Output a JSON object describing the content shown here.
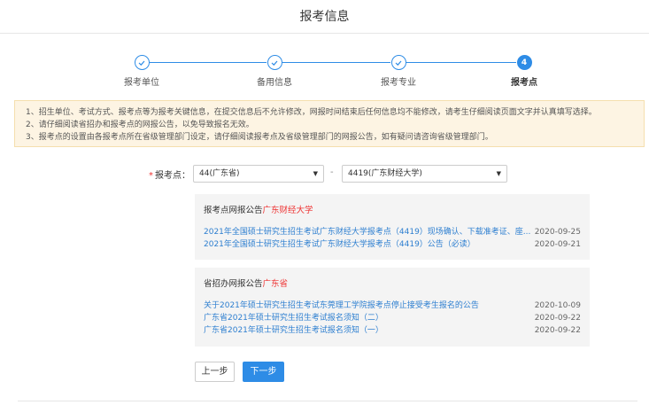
{
  "header": {
    "title": "报考信息"
  },
  "steps": [
    {
      "label": "报考单位",
      "state": "done"
    },
    {
      "label": "备用信息",
      "state": "done"
    },
    {
      "label": "报考专业",
      "state": "done"
    },
    {
      "label": "报考点",
      "state": "active",
      "number": "4"
    }
  ],
  "notice": {
    "lines": [
      "1、招生单位、考试方式、报考点等为报考关键信息，在提交信息后不允许修改，网报时间结束后任何信息均不能修改，请考生仔细阅读页面文字并认真填写选择。",
      "2、请仔细阅读省招办和报考点的网报公告，以免导致报名无效。",
      "3、报考点的设置由各报考点所在省级管理部门设定，请仔细阅读报考点及省级管理部门的网报公告，如有疑问请咨询省级管理部门。"
    ]
  },
  "selector": {
    "required_mark": "*",
    "label": "报考点：",
    "province_value": "44(广东省)",
    "separator": "-",
    "site_value": "4419(广东财经大学)",
    "arrow": "▼"
  },
  "site_panel": {
    "title": "报考点网报公告",
    "title_highlight": "广东财经大学",
    "items": [
      {
        "text": "2021年全国硕士研究生招生考试广东财经大学报考点（4419）现场确认、下载准考证、座...",
        "date": "2020-09-25"
      },
      {
        "text": "2021年全国硕士研究生招生考试广东财经大学报考点（4419）公告（必读）",
        "date": "2020-09-21"
      }
    ]
  },
  "province_panel": {
    "title": "省招办网报公告",
    "title_highlight": "广东省",
    "items": [
      {
        "text": "关于2021年硕士研究生招生考试东莞理工学院报考点停止接受考生报名的公告",
        "date": "2020-10-09"
      },
      {
        "text": "广东省2021年硕士研究生招生考试报名须知（二）",
        "date": "2020-09-22"
      },
      {
        "text": "广东省2021年硕士研究生招生考试报名须知（一）",
        "date": "2020-09-22"
      }
    ]
  },
  "buttons": {
    "prev": "上一步",
    "next": "下一步"
  },
  "colors": {
    "accent": "#2e8ce6",
    "highlight": "#e33333",
    "notice_bg": "#fdf4e3"
  }
}
